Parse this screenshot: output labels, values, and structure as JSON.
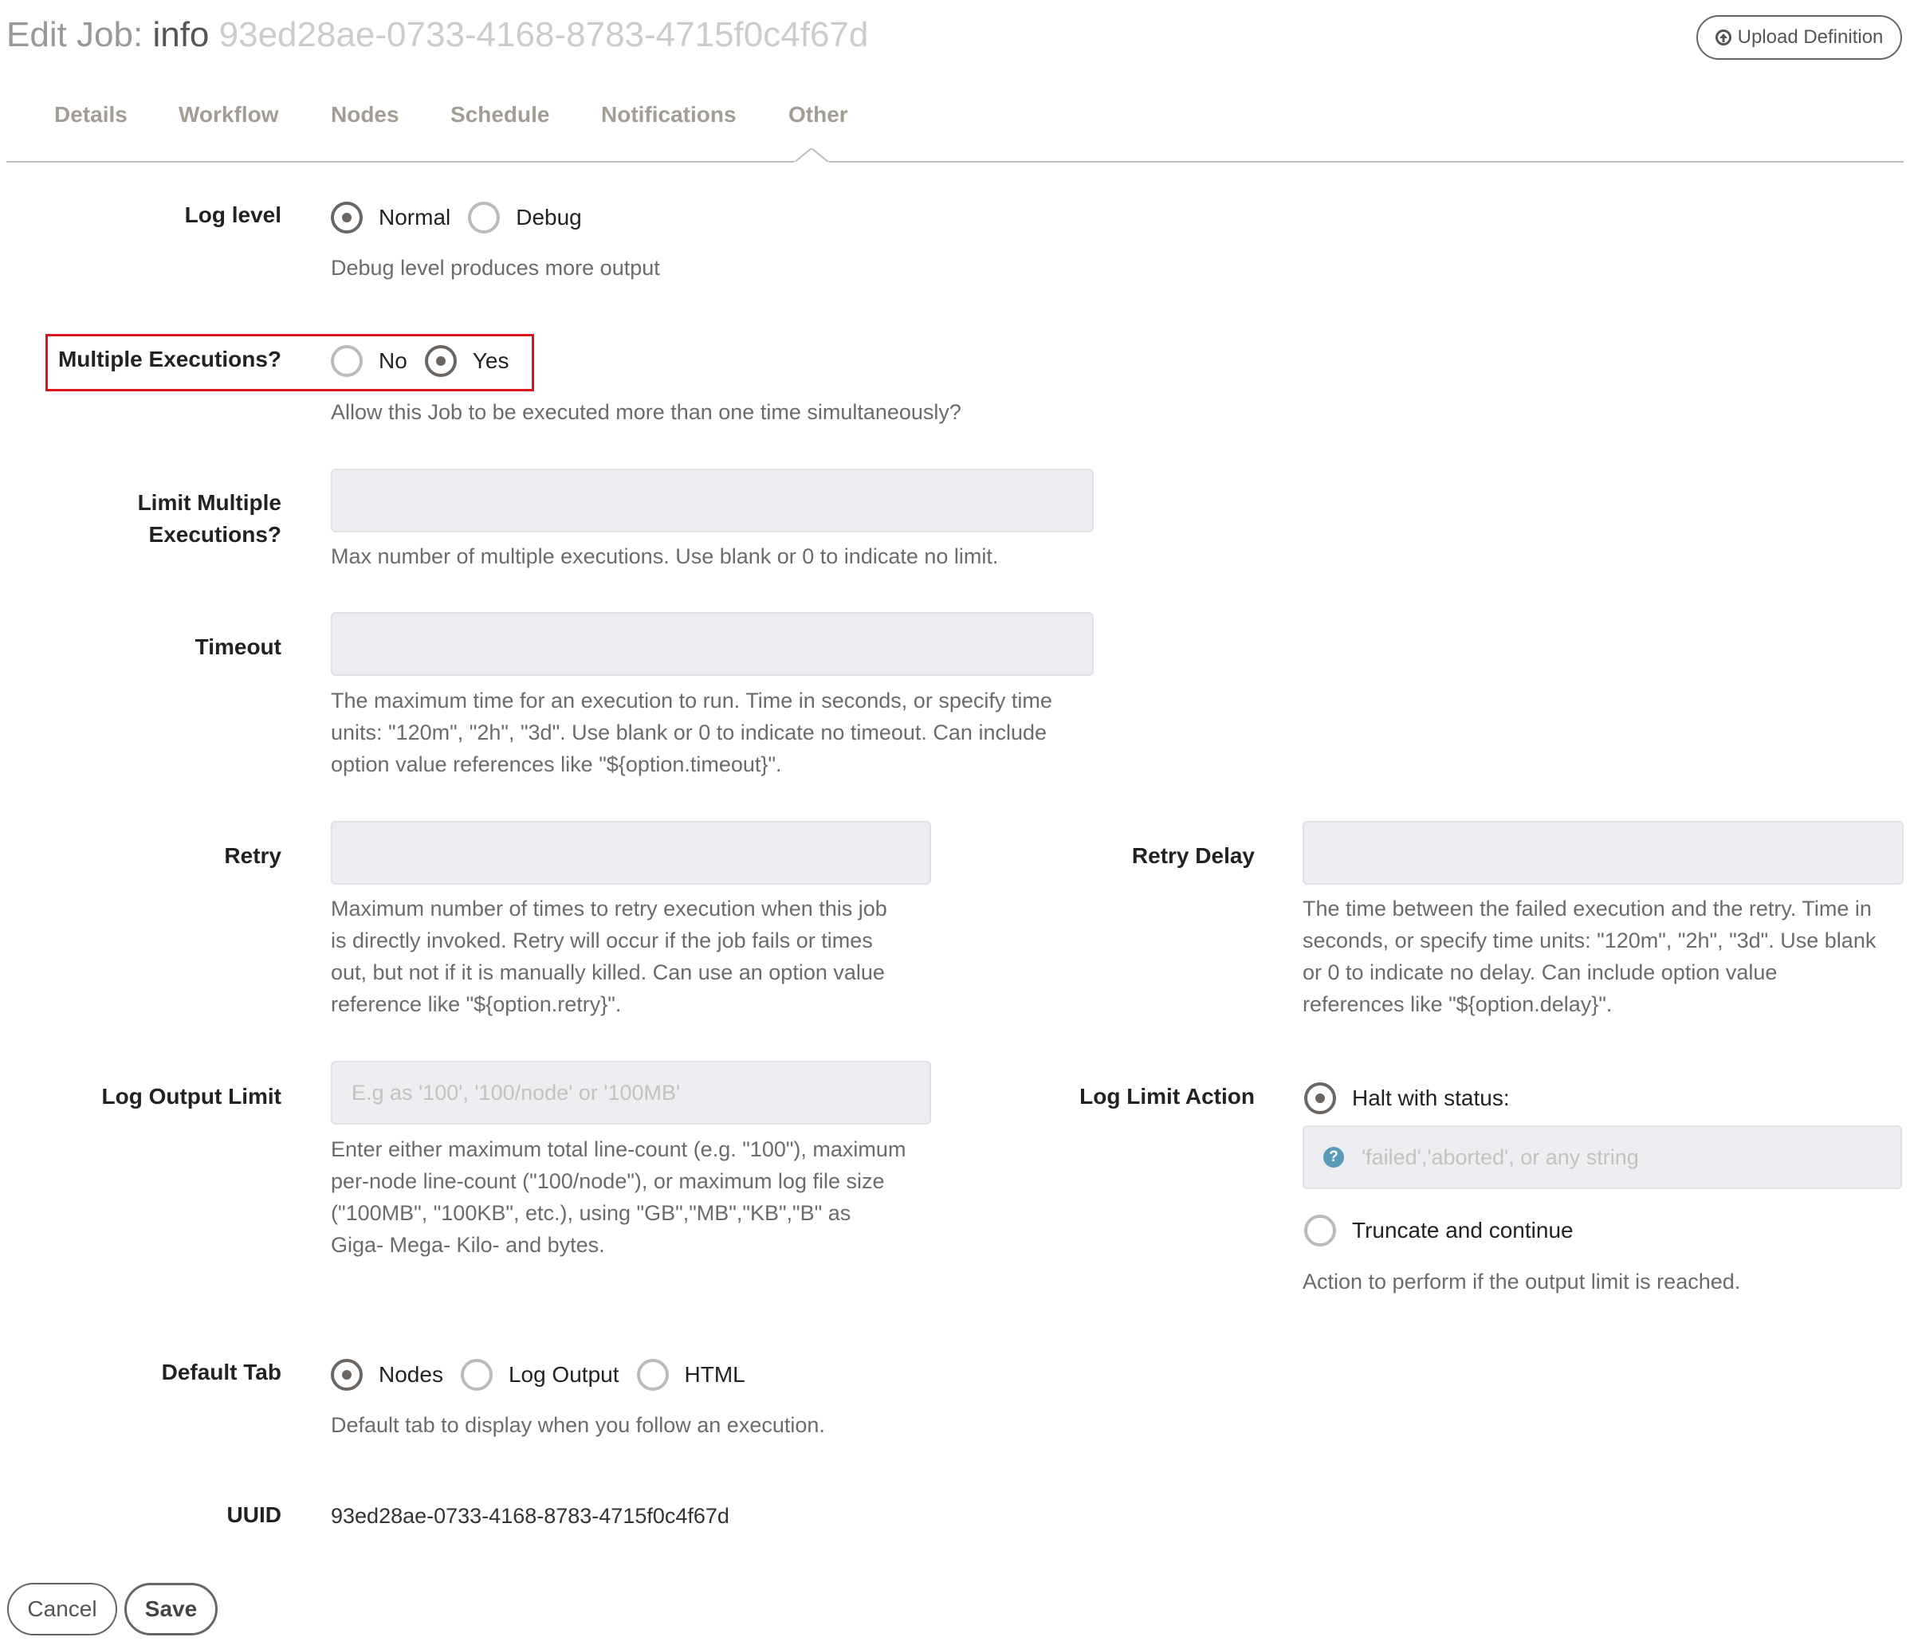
{
  "header": {
    "title_prefix": "Edit Job:",
    "job_name": "info",
    "job_uuid": "93ed28ae-0733-4168-8783-4715f0c4f67d",
    "upload_button": "Upload Definition"
  },
  "tabs": [
    {
      "label": "Details",
      "active": false
    },
    {
      "label": "Workflow",
      "active": false
    },
    {
      "label": "Nodes",
      "active": false
    },
    {
      "label": "Schedule",
      "active": false
    },
    {
      "label": "Notifications",
      "active": false
    },
    {
      "label": "Other",
      "active": true
    }
  ],
  "form": {
    "log_level": {
      "label": "Log level",
      "options": [
        {
          "label": "Normal",
          "checked": true
        },
        {
          "label": "Debug",
          "checked": false
        }
      ],
      "help": "Debug level produces more output"
    },
    "multiple_executions": {
      "label": "Multiple Executions?",
      "options": [
        {
          "label": "No",
          "checked": false
        },
        {
          "label": "Yes",
          "checked": true
        }
      ],
      "help": "Allow this Job to be executed more than one time simultaneously?",
      "highlight_color": "#d9141b"
    },
    "limit_multiple": {
      "label_line1": "Limit Multiple",
      "label_line2": "Executions?",
      "value": "",
      "help": "Max number of multiple executions. Use blank or 0 to indicate no limit."
    },
    "timeout": {
      "label": "Timeout",
      "value": "",
      "help": [
        "The maximum time for an execution to run. Time in seconds, or specify time",
        "units: \"120m\", \"2h\", \"3d\". Use blank or 0 to indicate no timeout. Can include",
        "option value references like \"${option.timeout}\"."
      ]
    },
    "retry": {
      "label": "Retry",
      "value": "",
      "help": [
        "Maximum number of times to retry execution when this job",
        "is directly invoked. Retry will occur if the job fails or times",
        "out, but not if it is manually killed. Can use an option value",
        "reference like \"${option.retry}\"."
      ]
    },
    "retry_delay": {
      "label": "Retry Delay",
      "value": "",
      "help": [
        "The time between the failed execution and the retry. Time in",
        "seconds, or specify time units: \"120m\", \"2h\", \"3d\". Use blank",
        "or 0 to indicate no delay. Can include option value",
        "references like \"${option.delay}\"."
      ]
    },
    "log_output_limit": {
      "label": "Log Output Limit",
      "value": "",
      "placeholder": "E.g as '100', '100/node' or '100MB'",
      "help": [
        "Enter either maximum total line-count (e.g. \"100\"), maximum",
        "per-node line-count (\"100/node\"), or maximum log file size",
        "(\"100MB\", \"100KB\", etc.), using \"GB\",\"MB\",\"KB\",\"B\" as",
        "Giga- Mega- Kilo- and bytes."
      ]
    },
    "log_limit_action": {
      "label": "Log Limit Action",
      "halt_label": "Halt with status:",
      "halt_checked": true,
      "status_value": "",
      "status_placeholder": "'failed','aborted', or any string",
      "truncate_label": "Truncate and continue",
      "truncate_checked": false,
      "help": "Action to perform if the output limit is reached."
    },
    "default_tab": {
      "label": "Default Tab",
      "options": [
        {
          "label": "Nodes",
          "checked": true
        },
        {
          "label": "Log Output",
          "checked": false
        },
        {
          "label": "HTML",
          "checked": false
        }
      ],
      "help": "Default tab to display when you follow an execution."
    },
    "uuid": {
      "label": "UUID",
      "value": "93ed28ae-0733-4168-8783-4715f0c4f67d"
    }
  },
  "actions": {
    "cancel": "Cancel",
    "save": "Save"
  },
  "colors": {
    "tab_text": "#a39e94",
    "highlight_border": "#d9141b",
    "help_icon": "#5a9ab8",
    "input_bg": "#eeeef2"
  }
}
